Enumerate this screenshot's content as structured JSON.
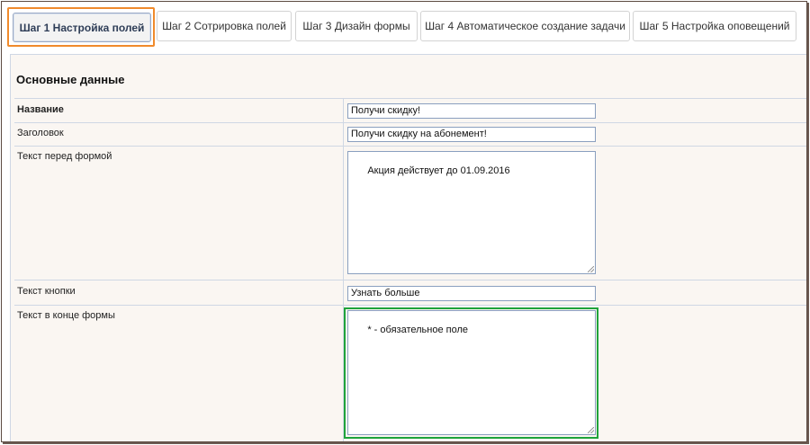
{
  "tabs": [
    {
      "label": "Шаг 1 Настройка полей",
      "active": true
    },
    {
      "label": "Шаг 2 Сотрировка полей"
    },
    {
      "label": "Шаг 3 Дизайн формы"
    },
    {
      "label": "Шаг 4 Автоматическое создание задачи"
    },
    {
      "label": "Шаг 5 Настройка оповещений"
    }
  ],
  "section": {
    "title": "Основные данные"
  },
  "fields": {
    "name": {
      "label": "Название",
      "value": "Получи скидку!"
    },
    "heading": {
      "label": "Заголовок",
      "value": "Получи скидку на абонемент!"
    },
    "text_before": {
      "label": "Текст перед формой",
      "value": "Акция действует до 01.09.2016"
    },
    "button_text": {
      "label": "Текст кнопки",
      "value": "Узнать больше"
    },
    "text_end": {
      "label": "Текст в конце формы",
      "value": "* - обязательное поле"
    }
  },
  "colors": {
    "active_tab_highlight": "#f08a2c",
    "focus_highlight": "#1fa33b"
  }
}
